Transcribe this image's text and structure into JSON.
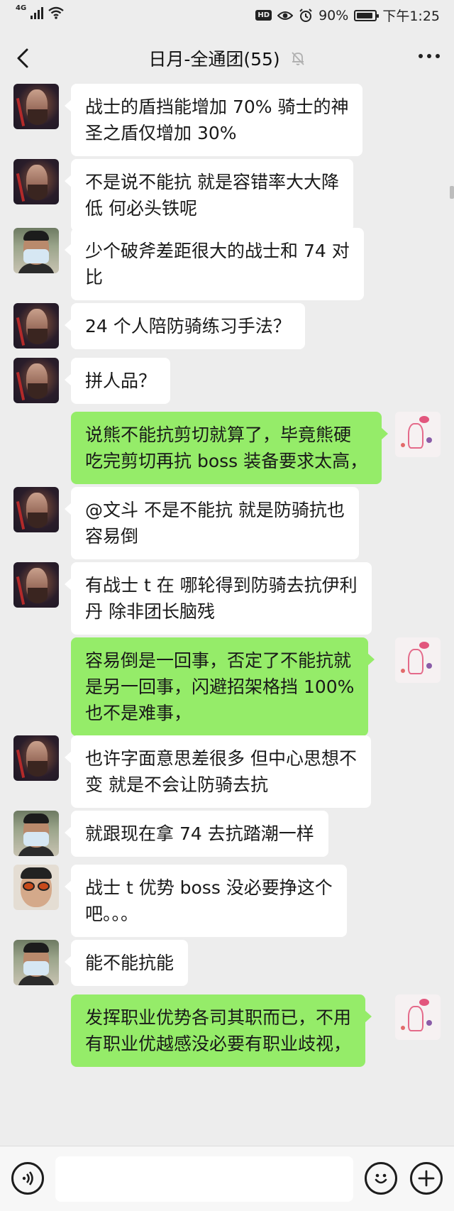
{
  "status_bar": {
    "network": "4G",
    "hd_label": "HD",
    "battery_percent": 90,
    "battery_label": "90%",
    "time": "下午1:25"
  },
  "nav": {
    "back_icon": "chevron-left-icon",
    "title": "日月-全通团(55)",
    "mute_icon": "bell-off-icon",
    "more_icon": "ellipsis-icon"
  },
  "messages": [
    {
      "side": "left",
      "avatar": "dark-portrait",
      "text": "战士的盾挡能增加 70%  骑士的神\n圣之盾仅增加 30%"
    },
    {
      "side": "left",
      "avatar": "dark-portrait",
      "text": "不是说不能抗 就是容错率大大降\n低  何必头铁呢"
    },
    {
      "side": "left",
      "avatar": "masked-man",
      "text": "少个破斧差距很大的战士和 74 对\n比"
    },
    {
      "side": "left",
      "avatar": "dark-portrait",
      "text": "24 个人陪防骑练习手法？"
    },
    {
      "side": "left",
      "avatar": "dark-portrait",
      "text": "拼人品？"
    },
    {
      "side": "right",
      "avatar": "drawing",
      "text": "说熊不能抗剪切就算了，毕竟熊硬\n吃完剪切再抗 boss 装备要求太高，"
    },
    {
      "side": "left",
      "avatar": "dark-portrait",
      "text": "@文斗  不是不能抗 就是防骑抗也\n容易倒"
    },
    {
      "side": "left",
      "avatar": "dark-portrait",
      "text": "有战士 t 在 哪轮得到防骑去抗伊利\n丹  除非团长脑残"
    },
    {
      "side": "right",
      "avatar": "drawing",
      "text": "容易倒是一回事，否定了不能抗就\n是另一回事，闪避招架格挡 100%\n也不是难事，"
    },
    {
      "side": "left",
      "avatar": "dark-portrait",
      "text": "也许字面意思差很多 但中心思想不\n变 就是不会让防骑去抗"
    },
    {
      "side": "left",
      "avatar": "masked-man",
      "text": "就跟现在拿 74 去抗踏潮一样"
    },
    {
      "side": "left",
      "avatar": "sunglasses-man",
      "text": "战士 t 优势 boss 没必要挣这个\n吧。。。"
    },
    {
      "side": "left",
      "avatar": "masked-man",
      "text": "能不能抗能"
    },
    {
      "side": "right",
      "avatar": "drawing",
      "text": "发挥职业优势各司其职而已，不用\n有职业优越感没必要有职业歧视，"
    }
  ],
  "input_bar": {
    "voice_icon": "voice-icon",
    "input_value": "",
    "emoji_icon": "emoji-icon",
    "plus_icon": "plus-icon"
  },
  "colors": {
    "background": "#ededed",
    "bubble_incoming": "#ffffff",
    "bubble_outgoing": "#95ec69"
  }
}
